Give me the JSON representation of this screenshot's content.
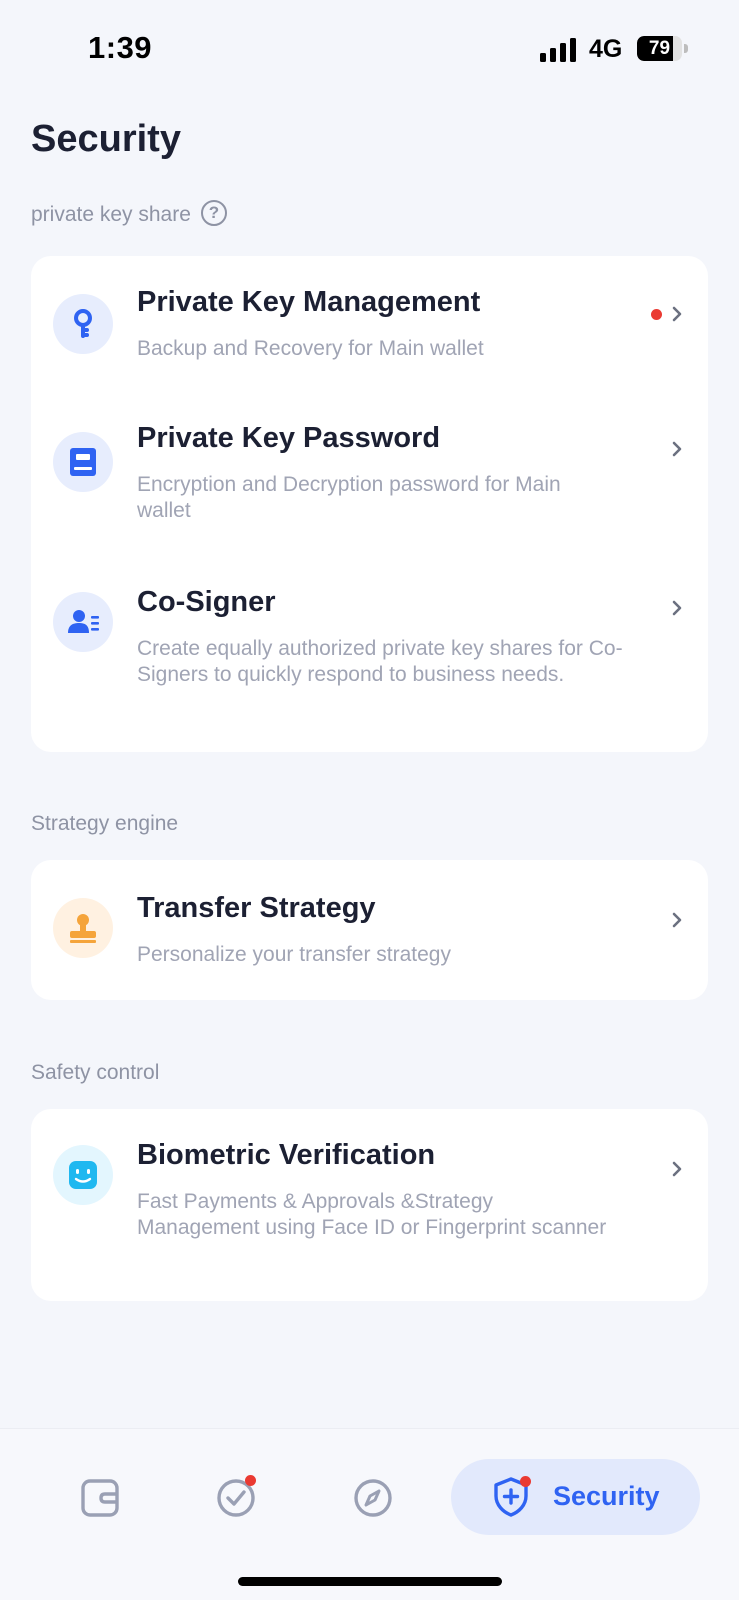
{
  "status_bar": {
    "time": "1:39",
    "network": "4G",
    "battery": "79",
    "battery_level": 0.79
  },
  "page": {
    "title": "Security"
  },
  "sections": {
    "private_key_share": {
      "label": "private key share",
      "help_glyph": "?",
      "items": [
        {
          "title": "Private Key Management",
          "description": "Backup and Recovery for Main wallet",
          "icon": "key-icon",
          "icon_color": "#2f63f2",
          "has_notification": true
        },
        {
          "title": "Private Key Password",
          "description": "Encryption and Decryption password for Main wallet",
          "icon": "password-book-icon",
          "icon_color": "#2f63f2"
        },
        {
          "title": "Co-Signer",
          "description": "Create equally authorized private key shares for Co-Signers to quickly respond to business needs.",
          "icon": "co-signer-icon",
          "icon_color": "#2f63f2"
        }
      ]
    },
    "strategy_engine": {
      "label": "Strategy engine",
      "items": [
        {
          "title": "Transfer Strategy",
          "description": "Personalize your transfer strategy",
          "icon": "stamp-icon",
          "icon_color": "#f5a43a"
        }
      ]
    },
    "safety_control": {
      "label": "Safety control",
      "items": [
        {
          "title": "Biometric Verification",
          "description": "Fast Payments & Approvals &Strategy Management using Face ID or Fingerprint scanner",
          "icon": "face-id-icon",
          "icon_color": "#1fb8f0"
        }
      ]
    }
  },
  "bottom_nav": {
    "items": [
      {
        "name": "wallet",
        "icon": "wallet-icon"
      },
      {
        "name": "approvals",
        "icon": "check-circle-icon",
        "has_notification": true
      },
      {
        "name": "discover",
        "icon": "compass-icon"
      },
      {
        "name": "security",
        "label": "Security",
        "icon": "shield-plus-icon",
        "active": true,
        "has_notification": true
      }
    ]
  },
  "colors": {
    "accent": "#2f63f2",
    "background": "#f4f6fb",
    "notification": "#ea3a32",
    "muted_text": "#a0a4b4"
  }
}
